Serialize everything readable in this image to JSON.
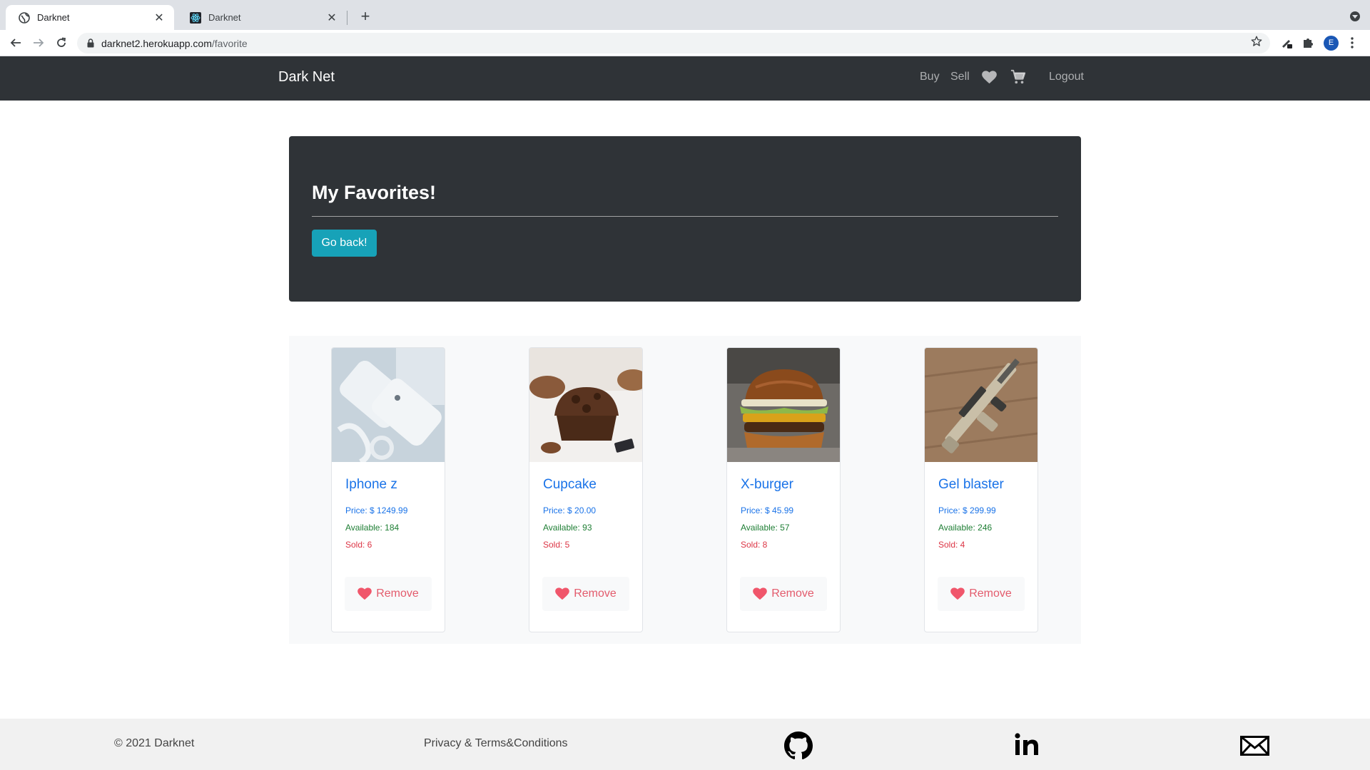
{
  "browser": {
    "tabs": [
      {
        "title": "Darknet",
        "active": true
      },
      {
        "title": "Darknet",
        "active": false
      }
    ],
    "url_host": "darknet2.herokuapp.com",
    "url_path": "/favorite",
    "profile_initial": "E"
  },
  "navbar": {
    "brand": "Dark Net",
    "links": {
      "buy": "Buy",
      "sell": "Sell",
      "logout": "Logout"
    },
    "icons": [
      "heart-icon",
      "cart-icon"
    ]
  },
  "jumbotron": {
    "title": "My Favorites!",
    "button_label": "Go back!"
  },
  "products": [
    {
      "name": "Iphone z",
      "price": "Price: $ 1249.99",
      "available": "Available: 184",
      "sold": "Sold: 6",
      "remove_label": "Remove",
      "image": "white-phone-photo"
    },
    {
      "name": "Cupcake",
      "price": "Price: $ 20.00",
      "available": "Available: 93",
      "sold": "Sold: 5",
      "remove_label": "Remove",
      "image": "chocolate-muffin-photo"
    },
    {
      "name": "X-burger",
      "price": "Price: $ 45.99",
      "available": "Available: 57",
      "sold": "Sold: 8",
      "remove_label": "Remove",
      "image": "burger-photo"
    },
    {
      "name": "Gel blaster",
      "price": "Price: $ 299.99",
      "available": "Available: 246",
      "sold": "Sold: 4",
      "remove_label": "Remove",
      "image": "toy-rifle-photo"
    }
  ],
  "footer": {
    "copyright": "© 2021 Darknet",
    "privacy": "Privacy & Terms&Conditions",
    "icons": [
      "github-icon",
      "linkedin-icon",
      "mail-icon"
    ]
  },
  "colors": {
    "navbar_bg": "#2f3337",
    "button_info": "#17a2b8",
    "link_blue": "#1a73e8",
    "available_green": "#1e7e34",
    "sold_red": "#dc3545",
    "remove_pink": "#e35b6c"
  }
}
